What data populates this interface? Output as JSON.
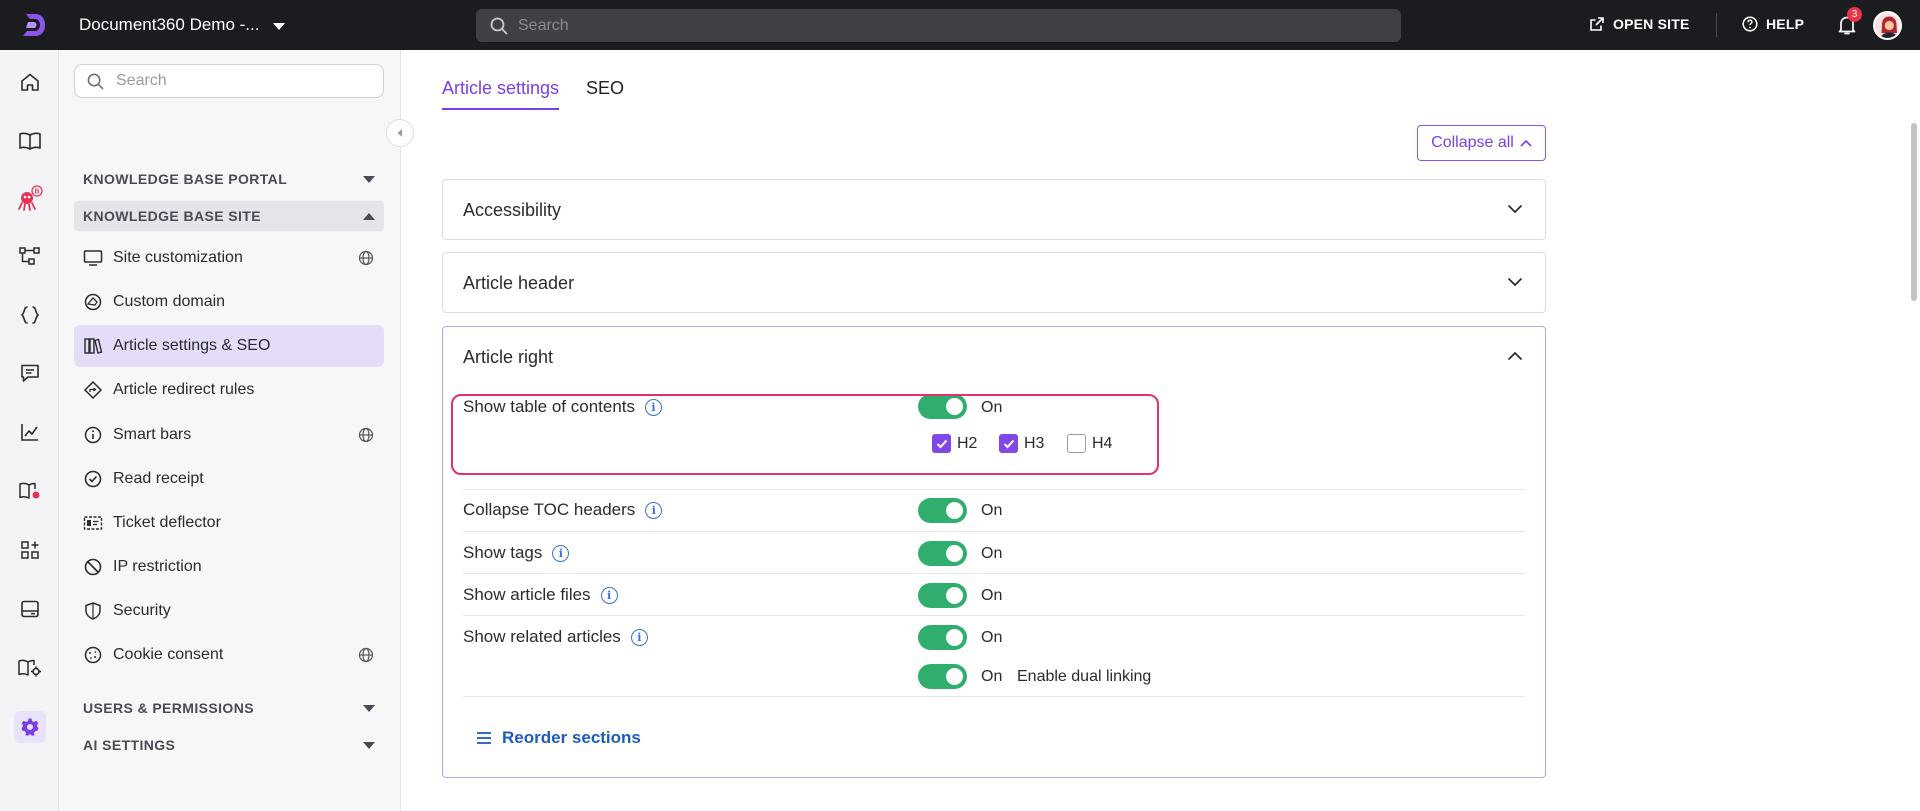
{
  "topbar": {
    "project_name": "Document360 Demo -...",
    "search_placeholder": "Search",
    "open_site_label": "OPEN SITE",
    "help_label": "HELP",
    "notification_count": "3"
  },
  "rail": {
    "icons": [
      "home-icon",
      "book-icon",
      "bot-icon",
      "workflow-icon",
      "code-icon",
      "feedback-icon",
      "analytics-icon",
      "knowledge-icon",
      "apps-icon",
      "widget-icon",
      "settings-portal-icon",
      "gear-icon"
    ],
    "active_icon": "gear-icon",
    "bot_badge": "B"
  },
  "sidebar": {
    "search_placeholder": "Search",
    "sections": {
      "portal": "KNOWLEDGE BASE PORTAL",
      "site": "KNOWLEDGE BASE SITE",
      "users": "USERS & PERMISSIONS",
      "ai": "AI SETTINGS"
    },
    "items": [
      {
        "label": "Site customization",
        "icon": "monitor-icon",
        "globe": true
      },
      {
        "label": "Custom domain",
        "icon": "domain-icon",
        "globe": false
      },
      {
        "label": "Article settings & SEO",
        "icon": "books-icon",
        "globe": false,
        "active": true
      },
      {
        "label": "Article redirect rules",
        "icon": "redirect-icon",
        "globe": false
      },
      {
        "label": "Smart bars",
        "icon": "info-icon",
        "globe": true
      },
      {
        "label": "Read receipt",
        "icon": "check-circle-icon",
        "globe": false
      },
      {
        "label": "Ticket deflector",
        "icon": "ticket-icon",
        "globe": false
      },
      {
        "label": "IP restriction",
        "icon": "ban-icon",
        "globe": false
      },
      {
        "label": "Security",
        "icon": "shield-icon",
        "globe": false
      },
      {
        "label": "Cookie consent",
        "icon": "cookie-icon",
        "globe": true
      }
    ]
  },
  "main": {
    "tabs": [
      {
        "label": "Article settings",
        "active": true
      },
      {
        "label": "SEO",
        "active": false
      }
    ],
    "collapse_all_label": "Collapse all",
    "panels": [
      {
        "title": "Accessibility",
        "expanded": false
      },
      {
        "title": "Article header",
        "expanded": false
      },
      {
        "title": "Article right",
        "expanded": true
      }
    ],
    "settings": [
      {
        "label": "Show table of contents",
        "toggle": true,
        "state": "On"
      },
      {
        "label": "Collapse TOC headers",
        "toggle": true,
        "state": "On"
      },
      {
        "label": "Show tags",
        "toggle": true,
        "state": "On"
      },
      {
        "label": "Show article files",
        "toggle": true,
        "state": "On"
      },
      {
        "label": "Show related articles",
        "toggle": true,
        "state": "On"
      }
    ],
    "toc_headings": [
      {
        "label": "H2",
        "checked": true
      },
      {
        "label": "H3",
        "checked": true
      },
      {
        "label": "H4",
        "checked": false
      }
    ],
    "dual_linking": {
      "state": "On",
      "label": "Enable dual linking"
    },
    "reorder_label": "Reorder sections"
  },
  "colors": {
    "accent": "#7a3fe4",
    "toggle_on": "#2fae6d",
    "highlight": "#e3306f",
    "link": "#1d5bbf"
  }
}
